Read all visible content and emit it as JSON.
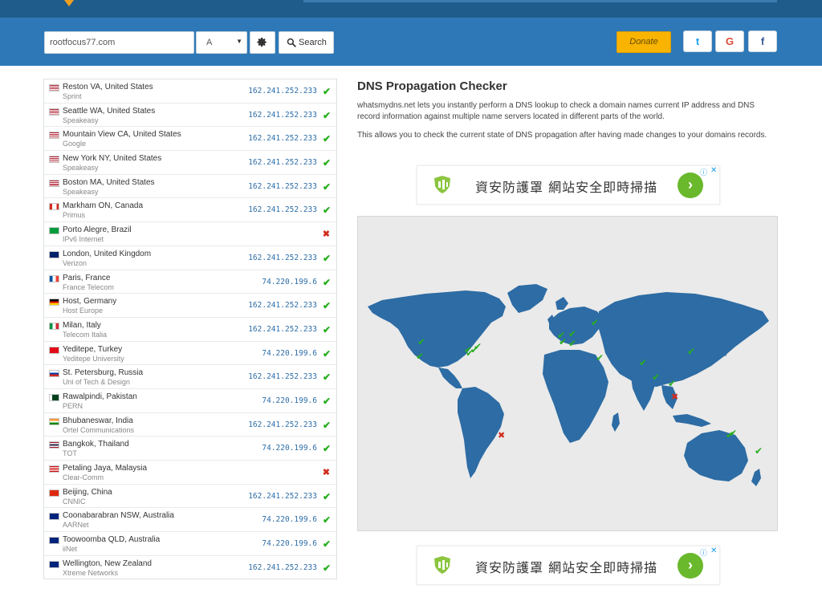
{
  "toolbar": {
    "domain_value": "rootfocus77.com",
    "record_type": "A",
    "search_label": "Search",
    "donate_label": "Donate",
    "social": {
      "twitter": "t",
      "google": "G",
      "facebook": "f"
    }
  },
  "results": [
    {
      "location": "Reston VA, United States",
      "isp": "Sprint",
      "ip": "162.241.252.233",
      "status": "ok",
      "flag": "us"
    },
    {
      "location": "Seattle WA, United States",
      "isp": "Speakeasy",
      "ip": "162.241.252.233",
      "status": "ok",
      "flag": "us"
    },
    {
      "location": "Mountain View CA, United States",
      "isp": "Google",
      "ip": "162.241.252.233",
      "status": "ok",
      "flag": "us"
    },
    {
      "location": "New York NY, United States",
      "isp": "Speakeasy",
      "ip": "162.241.252.233",
      "status": "ok",
      "flag": "us"
    },
    {
      "location": "Boston MA, United States",
      "isp": "Speakeasy",
      "ip": "162.241.252.233",
      "status": "ok",
      "flag": "us"
    },
    {
      "location": "Markham ON, Canada",
      "isp": "Primus",
      "ip": "162.241.252.233",
      "status": "ok",
      "flag": "ca"
    },
    {
      "location": "Porto Alegre, Brazil",
      "isp": "IPv6 Internet",
      "ip": "",
      "status": "fail",
      "flag": "br"
    },
    {
      "location": "London, United Kingdom",
      "isp": "Verizon",
      "ip": "162.241.252.233",
      "status": "ok",
      "flag": "gb"
    },
    {
      "location": "Paris, France",
      "isp": "France Telecom",
      "ip": "74.220.199.6",
      "status": "ok",
      "flag": "fr"
    },
    {
      "location": "Host, Germany",
      "isp": "Host Europe",
      "ip": "162.241.252.233",
      "status": "ok",
      "flag": "de"
    },
    {
      "location": "Milan, Italy",
      "isp": "Telecom Italia",
      "ip": "162.241.252.233",
      "status": "ok",
      "flag": "it"
    },
    {
      "location": "Yeditepe, Turkey",
      "isp": "Yeditepe University",
      "ip": "74.220.199.6",
      "status": "ok",
      "flag": "tr"
    },
    {
      "location": "St. Petersburg, Russia",
      "isp": "Uni of Tech & Design",
      "ip": "162.241.252.233",
      "status": "ok",
      "flag": "ru"
    },
    {
      "location": "Rawalpindi, Pakistan",
      "isp": "PERN",
      "ip": "74.220.199.6",
      "status": "ok",
      "flag": "pk"
    },
    {
      "location": "Bhubaneswar, India",
      "isp": "Ortel Communications",
      "ip": "162.241.252.233",
      "status": "ok",
      "flag": "in"
    },
    {
      "location": "Bangkok, Thailand",
      "isp": "TOT",
      "ip": "74.220.199.6",
      "status": "ok",
      "flag": "th"
    },
    {
      "location": "Petaling Jaya, Malaysia",
      "isp": "Clear-Comm",
      "ip": "",
      "status": "fail",
      "flag": "my"
    },
    {
      "location": "Beijing, China",
      "isp": "CNNIC",
      "ip": "162.241.252.233",
      "status": "ok",
      "flag": "cn"
    },
    {
      "location": "Coonabarabran NSW, Australia",
      "isp": "AARNet",
      "ip": "74.220.199.6",
      "status": "ok",
      "flag": "au"
    },
    {
      "location": "Toowoomba QLD, Australia",
      "isp": "iiNet",
      "ip": "74.220.199.6",
      "status": "ok",
      "flag": "au"
    },
    {
      "location": "Wellington, New Zealand",
      "isp": "Xtreme Networks",
      "ip": "162.241.252.233",
      "status": "ok",
      "flag": "nz"
    }
  ],
  "content": {
    "title": "DNS Propagation Checker",
    "paragraph1": "whatsmydns.net lets you instantly perform a DNS lookup to check a domain names current IP address and DNS record information against multiple name servers located in different parts of the world.",
    "paragraph2": "This allows you to check the current state of DNS propagation after having made changes to your domains records."
  },
  "ads": [
    {
      "text": "資安防護罩 網站安全即時掃描"
    },
    {
      "text": "資安防護罩 網站安全即時掃描"
    }
  ],
  "colors": {
    "header": "#1f5c8c",
    "toolbar": "#2e78b7",
    "donate": "#f8b400",
    "land": "#2d6ca4",
    "ok": "#27ae1e",
    "fail": "#d22d1e"
  }
}
